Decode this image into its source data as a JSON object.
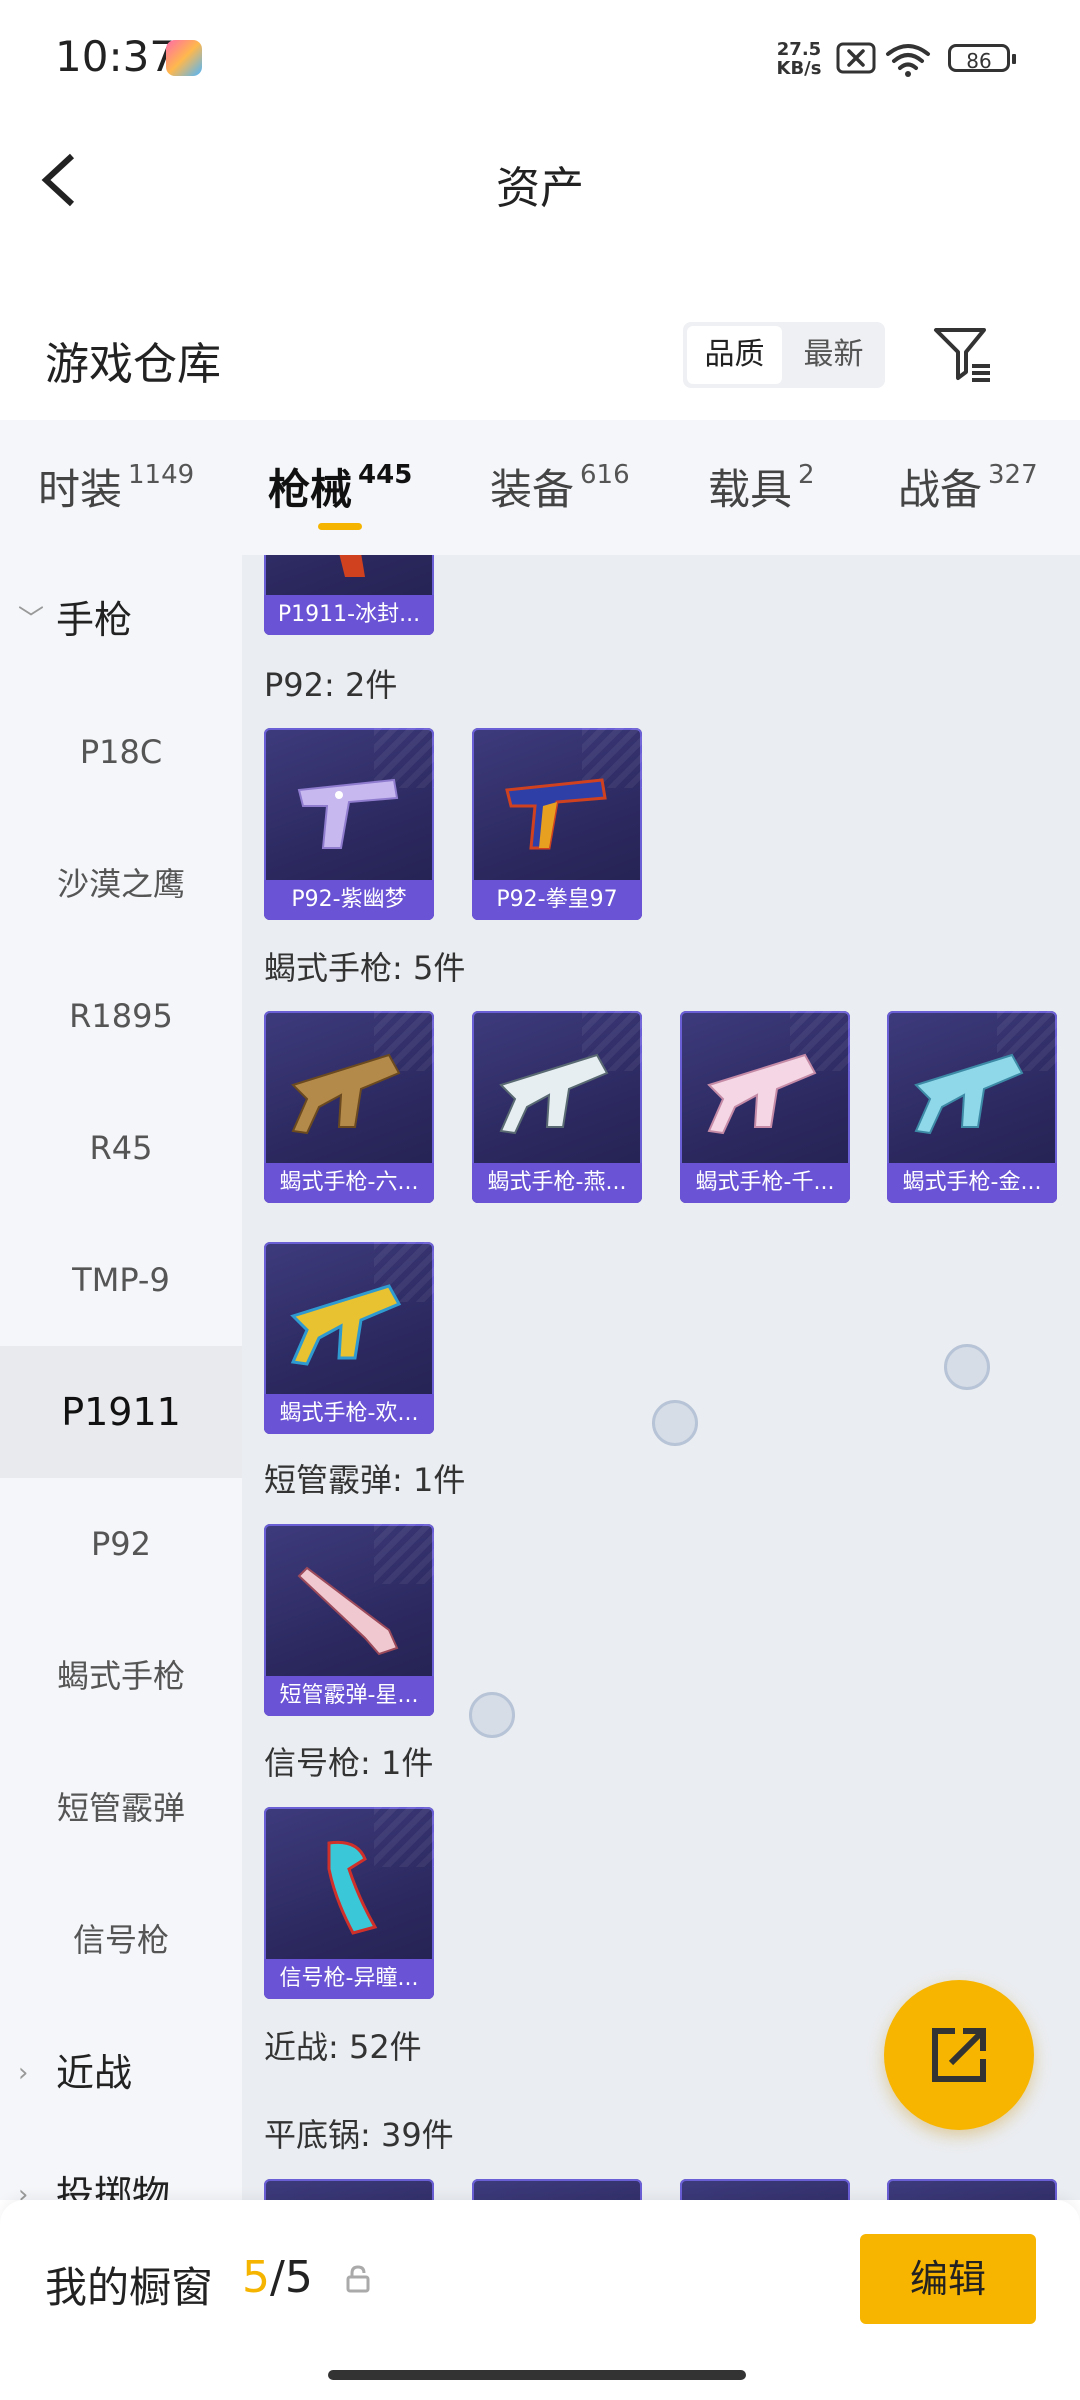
{
  "status_bar": {
    "time": "10:37",
    "net_speed_value": "27.5",
    "net_speed_unit": "KB/s",
    "battery": "86"
  },
  "nav": {
    "title": "资产"
  },
  "section": {
    "title": "游戏仓库",
    "sort_options": [
      "品质",
      "最新"
    ],
    "active_sort": "品质"
  },
  "category_tabs": [
    {
      "label": "时装",
      "count": "1149"
    },
    {
      "label": "枪械",
      "count": "445"
    },
    {
      "label": "装备",
      "count": "616"
    },
    {
      "label": "载具",
      "count": "2"
    },
    {
      "label": "战备",
      "count": "327"
    }
  ],
  "active_category": "枪械",
  "sidebar": {
    "group_open": "手枪",
    "items": [
      "P18C",
      "沙漠之鹰",
      "R1895",
      "R45",
      "TMP-9",
      "P1911",
      "P92",
      "蝎式手枪",
      "短管霰弹",
      "信号枪"
    ],
    "active_item": "P1911",
    "group_closed": "近战",
    "group_partial": "投掷物"
  },
  "content": {
    "top_partial_item": "P1911-冰封...",
    "groups": [
      {
        "title": "P92: 2件",
        "items": [
          "P92-紫幽梦",
          "P92-拳皇97"
        ]
      },
      {
        "title": "蝎式手枪: 5件",
        "items": [
          "蝎式手枪-六...",
          "蝎式手枪-燕...",
          "蝎式手枪-千...",
          "蝎式手枪-金...",
          "蝎式手枪-欢..."
        ]
      },
      {
        "title": "短管霰弹: 1件",
        "items": [
          "短管霰弹-星..."
        ]
      },
      {
        "title": "信号枪: 1件",
        "items": [
          "信号枪-异瞳..."
        ]
      },
      {
        "title": "近战: 52件",
        "items": []
      },
      {
        "title": "平底锅: 39件",
        "items": []
      }
    ]
  },
  "bottom_bar": {
    "title": "我的橱窗",
    "current": "5",
    "separator": "/",
    "total": "5",
    "edit_label": "编辑"
  },
  "icons": {
    "back": "chevron-left-icon",
    "filter": "filter-icon",
    "share": "share-external-icon",
    "lock": "lock-icon",
    "wifi": "wifi-icon",
    "sim": "sim-off-icon"
  },
  "colors": {
    "accent": "#f5b400",
    "card_bg": "#2c2960",
    "card_caption": "#6a53d4"
  }
}
